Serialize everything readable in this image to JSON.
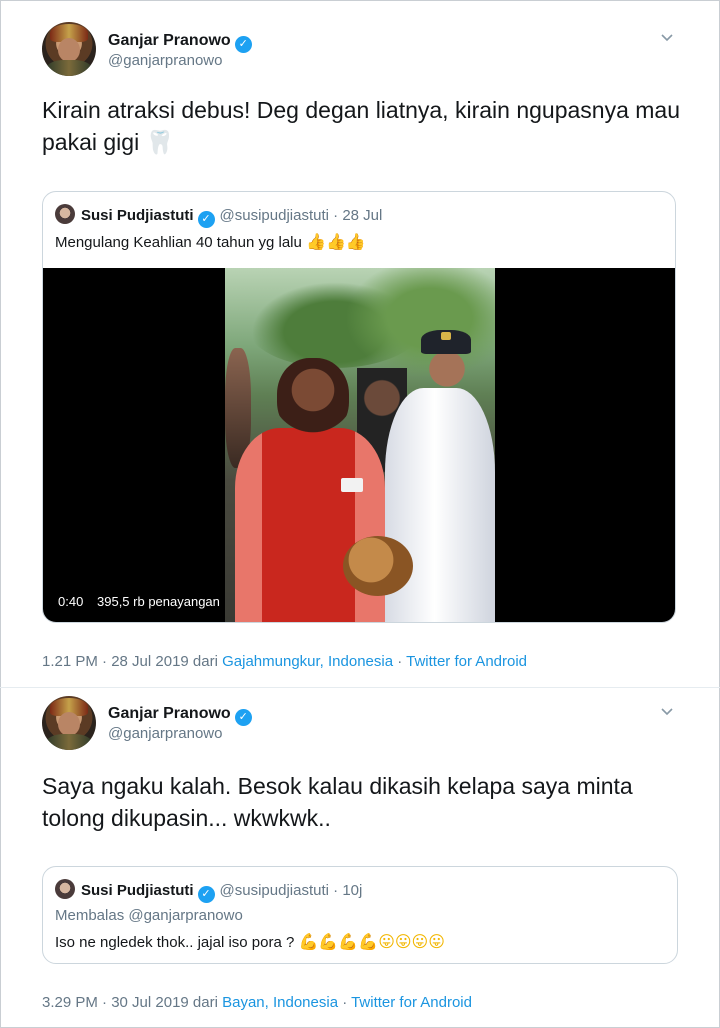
{
  "tweets": [
    {
      "author": {
        "name": "Ganjar Pranowo",
        "handle": "@ganjarpranowo"
      },
      "text": "Kirain atraksi debus! Deg degan liatnya, kirain ngupasnya mau pakai gigi",
      "text_emoji": "🦷",
      "quote": {
        "name": "Susi Pudjiastuti",
        "handle": "@susipudjiastuti",
        "sep": "·",
        "date": "28 Jul",
        "text": "Mengulang Keahlian 40 tahun yg lalu",
        "emoji": "👍👍👍",
        "video": {
          "duration": "0:40",
          "views": "395,5 rb penayangan"
        }
      },
      "meta": {
        "time": "1.21 PM · 28 Jul 2019 dari ",
        "location": "Gajahmungkur, Indonesia",
        "sep": " · ",
        "source": "Twitter for Android"
      }
    },
    {
      "author": {
        "name": "Ganjar Pranowo",
        "handle": "@ganjarpranowo"
      },
      "text": "Saya ngaku kalah. Besok kalau dikasih kelapa saya minta tolong dikupasin... wkwkwk..",
      "quote": {
        "name": "Susi Pudjiastuti",
        "handle": "@susipudjiastuti",
        "sep": "·",
        "date": "10j",
        "reply": "Membalas @ganjarpranowo",
        "text": "Iso ne ngledek thok.. jajal iso pora ?",
        "emoji_muscle": "💪💪💪💪",
        "emoji_face": "😛😛😛😛"
      },
      "meta": {
        "time": "3.29 PM · 30 Jul 2019 dari ",
        "location": "Bayan, Indonesia",
        "sep": " · ",
        "source": "Twitter for Android"
      }
    }
  ],
  "icons": {
    "verified": "✓",
    "chevron": "chevron-down-icon"
  }
}
